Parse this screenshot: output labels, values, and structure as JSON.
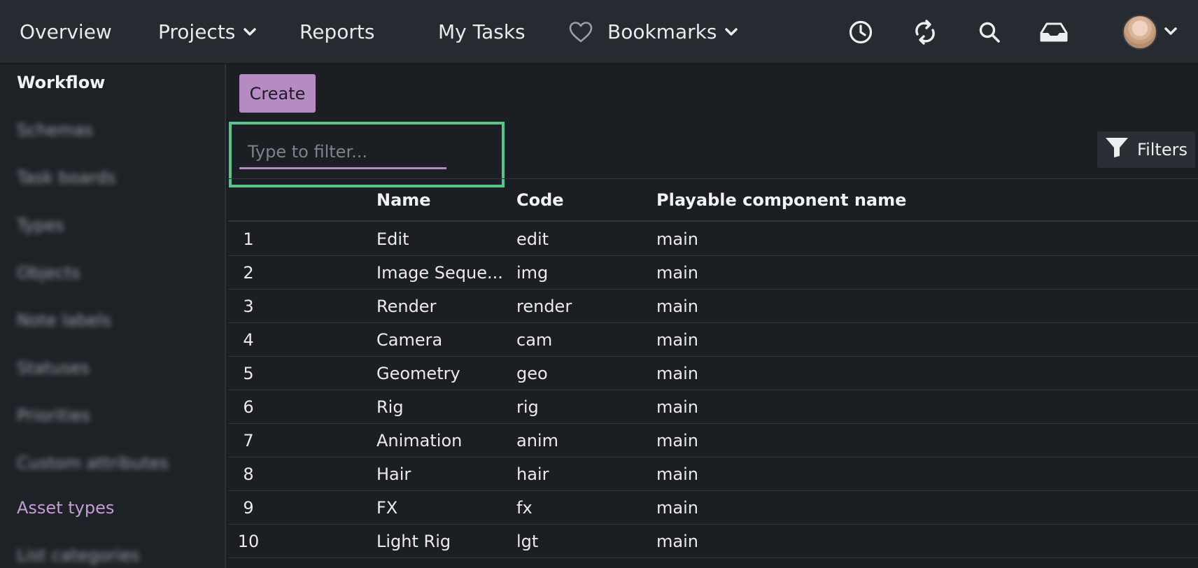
{
  "nav": {
    "items": [
      {
        "label": "Overview"
      },
      {
        "label": "Projects",
        "has_dropdown": true
      },
      {
        "label": "Reports"
      },
      {
        "label": "My Tasks"
      },
      {
        "label": "Bookmarks",
        "has_dropdown": true,
        "icon": "heart-icon"
      }
    ],
    "right_icons": [
      "clock-icon",
      "sync-icon",
      "search-icon",
      "inbox-icon",
      "avatar"
    ]
  },
  "sidebar": {
    "heading": "Workflow",
    "items": [
      {
        "label": "Schemas",
        "blurred": true
      },
      {
        "label": "Task boards",
        "blurred": true
      },
      {
        "label": "Types",
        "blurred": true
      },
      {
        "label": "Objects",
        "blurred": true
      },
      {
        "label": "Note labels",
        "blurred": true
      },
      {
        "label": "Statuses",
        "blurred": true
      },
      {
        "label": "Priorities",
        "blurred": true
      },
      {
        "label": "Custom attributes",
        "blurred": true
      },
      {
        "label": "Asset types",
        "active": true
      },
      {
        "label": "List categories",
        "blurred": true
      }
    ]
  },
  "toolbar": {
    "create_label": "Create",
    "filter_placeholder": "Type to filter...",
    "filter_value": "",
    "filters_label": "Filters"
  },
  "table": {
    "columns": [
      "",
      "Name",
      "Code",
      "Playable component name"
    ],
    "rows": [
      [
        "1",
        "Edit",
        "edit",
        "main"
      ],
      [
        "2",
        "Image Seque...",
        "img",
        "main"
      ],
      [
        "3",
        "Render",
        "render",
        "main"
      ],
      [
        "4",
        "Camera",
        "cam",
        "main"
      ],
      [
        "5",
        "Geometry",
        "geo",
        "main"
      ],
      [
        "6",
        "Rig",
        "rig",
        "main"
      ],
      [
        "7",
        "Animation",
        "anim",
        "main"
      ],
      [
        "8",
        "Hair",
        "hair",
        "main"
      ],
      [
        "9",
        "FX",
        "fx",
        "main"
      ],
      [
        "10",
        "Light Rig",
        "lgt",
        "main"
      ]
    ]
  },
  "colors": {
    "accent": "#b68bc4",
    "highlight": "#58c48a",
    "background": "#1b1f24",
    "topbar": "#262b31"
  }
}
